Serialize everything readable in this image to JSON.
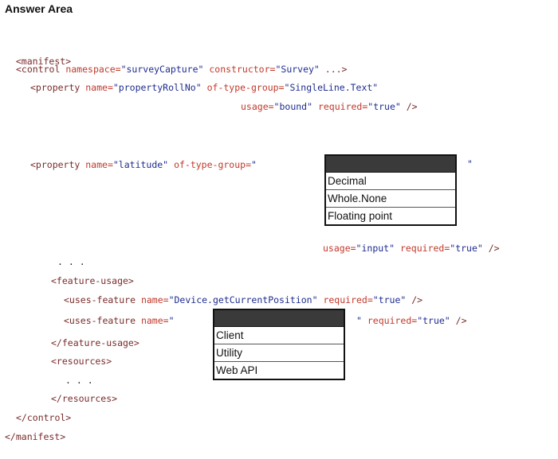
{
  "title": "Answer Area",
  "code": {
    "manifest_open": "<manifest>",
    "control_open": "<control",
    "control_ns_attr": "namespace=",
    "control_ns_val": "\"surveyCapture\"",
    "control_ctor_attr": "constructor=",
    "control_ctor_val": "\"Survey\"",
    "control_tail": " ...>",
    "prop1_open": "<property",
    "prop1_name_attr": "name=",
    "prop1_name_val": "\"propertyRollNo\"",
    "prop1_type_attr": "of-type-group=",
    "prop1_type_val": "\"SingleLine.Text\"",
    "prop1_usage_attr": "usage=",
    "prop1_usage_val": "\"bound\"",
    "prop1_req_attr": "required=",
    "prop1_req_val": "\"true\"",
    "prop1_close": " />",
    "prop2_open": "<property",
    "prop2_name_attr": "name=",
    "prop2_name_val": "\"latitude\"",
    "prop2_type_attr": "of-type-group=",
    "prop2_type_quote": "\"",
    "prop2_end_quote": "\"",
    "prop2_usage_attr": "usage=",
    "prop2_usage_val": "\"input\"",
    "prop2_req_attr": "required=",
    "prop2_req_val": "\"true\"",
    "prop2_close": " />",
    "ellipsis1": ". . .",
    "feature_usage_open": "<feature-usage>",
    "uses1_open": "<uses-feature",
    "uses1_name_attr": "name=",
    "uses1_name_val": "\"Device.getCurrentPosition\"",
    "uses1_req_attr": "required=",
    "uses1_req_val": "\"true\"",
    "uses1_close": " />",
    "uses2_open": "<uses-feature",
    "uses2_name_attr": "name=",
    "uses2_name_quote": "\"",
    "uses2_end_quote": "\"",
    "uses2_req_attr": "required=",
    "uses2_req_val": "\"true\"",
    "uses2_close": " />",
    "feature_usage_close": "</feature-usage>",
    "resources_open": "<resources>",
    "ellipsis2": ". . .",
    "resources_close": "</resources>",
    "control_close": "</control>",
    "manifest_close": "</manifest>"
  },
  "dropdown_type": {
    "options": [
      "Decimal",
      "Whole.None",
      "Floating point"
    ]
  },
  "dropdown_feature": {
    "options": [
      "Client",
      "Utility",
      "Web API"
    ]
  }
}
